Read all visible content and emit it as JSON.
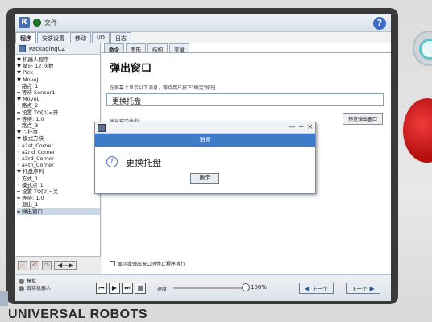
{
  "app": {
    "title": "文件",
    "help_icon": "help-icon"
  },
  "tabs": [
    "程序",
    "安装设置",
    "移动",
    "I/O",
    "日志"
  ],
  "file": {
    "name": "PackagingCZ"
  },
  "tree": [
    "▼ 机器人程序",
    "  ▼ 循环 12 次数",
    "    ▼ Pick",
    "      ▼ MoveJ",
    "          ◦ 路点_1",
    "          ━ 等待 Sensor1",
    "      ▼ MoveL",
    "          ◦ 路点_2",
    "          ━ 设置 TO[0]=开",
    "          ━ 等待: 1.0",
    "          ◦ 路点_3",
    "    ▼ ∴ 托盘",
    "      ▼ 模式方块",
    "          ◦ a1st_Corner",
    "          ◦ a2nd_Corner",
    "          ◦ a3rd_Corner",
    "          ◦ a4th_Corner",
    "      ▼ 托盘序列",
    "          ◦ 方式_1",
    "          ◦ 模式点_1",
    "          ━ 设置 TO[0]=关",
    "          ━ 等待: 1.0",
    "          ◦ 退出_1",
    "  ━ 弹出窗口"
  ],
  "subtabs": [
    "命令",
    "图形",
    "结构",
    "变量"
  ],
  "panel": {
    "title": "弹出窗口",
    "description": "在屏幕上显示以下消息，等待用户按下\"确定\"按钮",
    "message_value": "更换托盘",
    "type_label": "弹出窗口类型:",
    "preview_button": "预览弹出窗口",
    "checkbox_label": "显示此弹出窗口时停止程序执行"
  },
  "dialog": {
    "window_controls": [
      "—",
      "+",
      "×"
    ],
    "header": "消息",
    "message": "更换托盘",
    "ok_button": "确定"
  },
  "status": {
    "line1": "模拟",
    "line2": "真实机器人"
  },
  "player": {
    "speed_label": "速度",
    "speed_value": "100%",
    "speed_fraction": 1.0
  },
  "nav": {
    "prev": "上一个",
    "next": "下一个"
  },
  "footer": {
    "brand": "UNIVERSAL ROBOTS"
  }
}
